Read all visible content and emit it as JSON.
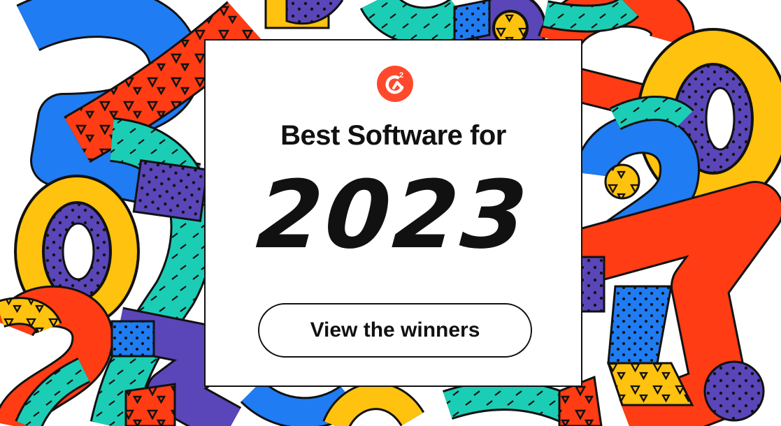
{
  "brand": {
    "logo_icon": "g2-logo-icon",
    "logo_color": "#ff492c"
  },
  "banner": {
    "headline": "Best Software for",
    "year": "2023",
    "cta_label": "View the winners"
  },
  "colors": {
    "blue": "#1f7cf2",
    "red": "#ff3c13",
    "teal": "#1ccdb5",
    "yellow": "#ffc20e",
    "purple": "#5a46b9",
    "outline": "#111111"
  }
}
